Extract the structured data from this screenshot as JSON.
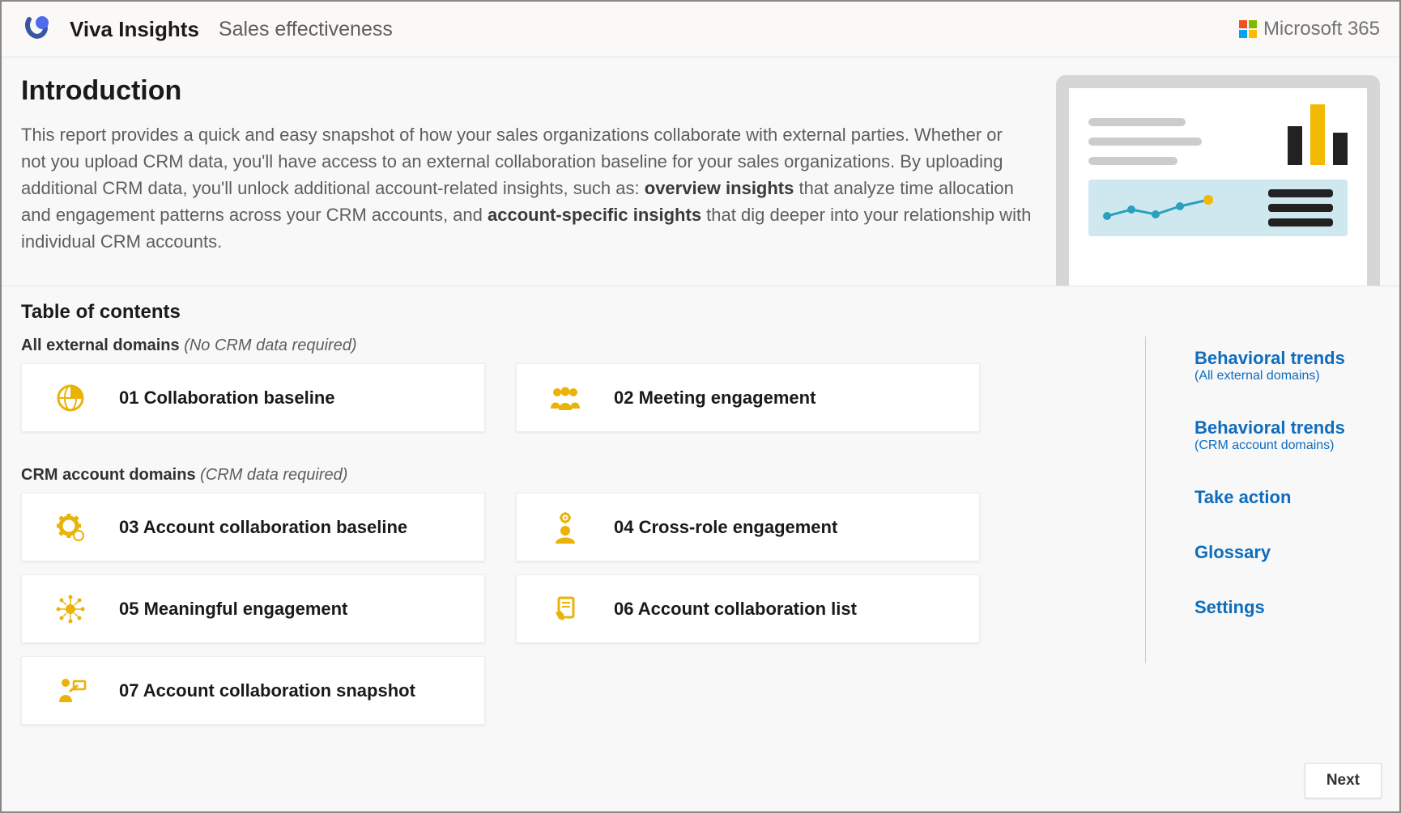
{
  "header": {
    "app_title": "Viva Insights",
    "page_subtitle": "Sales effectiveness",
    "brand_label": "Microsoft 365"
  },
  "intro": {
    "heading": "Introduction",
    "body_part1": "This report provides a quick and easy snapshot of how your sales organizations collaborate with external parties. Whether or not you upload CRM data, you'll have access to an external collaboration baseline for your sales organizations. By uploading additional CRM data, you'll unlock additional account-related insights, such as: ",
    "body_bold1": "overview insights",
    "body_part2": " that analyze time allocation and engagement patterns across your CRM accounts, and ",
    "body_bold2": "account-specific insights",
    "body_part3": " that dig deeper into your relationship with individual CRM accounts."
  },
  "toc": {
    "heading": "Table of contents",
    "group1_label": "All external domains",
    "group1_note": "(No CRM data required)",
    "group2_label": "CRM account domains",
    "group2_note": "(CRM data required)",
    "cards": {
      "c01": "01 Collaboration baseline",
      "c02": "02 Meeting engagement",
      "c03": "03 Account collaboration baseline",
      "c04": "04 Cross-role engagement",
      "c05": "05 Meaningful engagement",
      "c06": "06 Account collaboration list",
      "c07": "07 Account collaboration snapshot"
    }
  },
  "links": {
    "l1_title": "Behavioral trends",
    "l1_sub": "(All external domains)",
    "l2_title": "Behavioral trends",
    "l2_sub": "(CRM account domains)",
    "l3_title": "Take action",
    "l4_title": "Glossary",
    "l5_title": "Settings"
  },
  "footer": {
    "next_label": "Next"
  }
}
